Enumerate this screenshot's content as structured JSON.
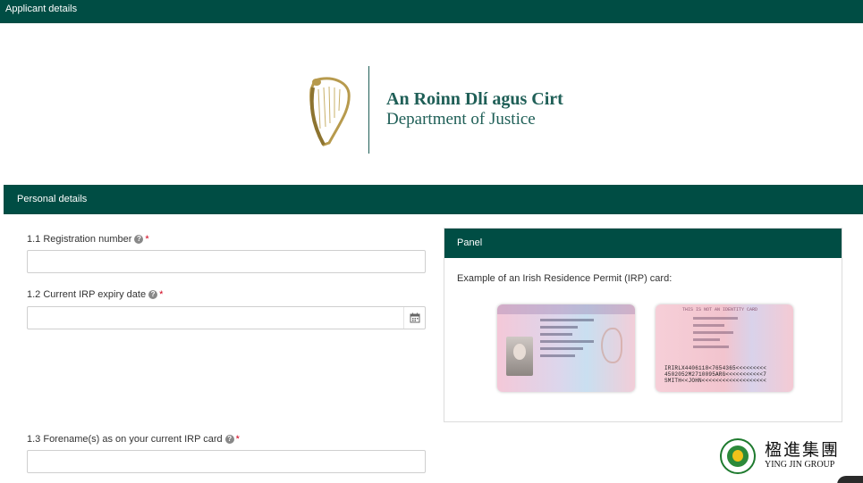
{
  "header": {
    "title": "Applicant details"
  },
  "logo": {
    "name_ga": "An Roinn Dlí agus Cirt",
    "name_en": "Department of Justice",
    "icon": "harp-icon"
  },
  "section": {
    "title": "Personal details"
  },
  "fields": {
    "registration_number": {
      "label": "1.1 Registration number",
      "value": "",
      "placeholder": ""
    },
    "irp_expiry": {
      "label": "1.2 Current IRP expiry date",
      "value": "",
      "placeholder": ""
    },
    "forenames": {
      "label": "1.3 Forename(s) as on your current IRP card",
      "value": "",
      "placeholder": ""
    },
    "help_glyph": "?",
    "required_marker": "*"
  },
  "panel": {
    "title": "Panel",
    "description": "Example of an Irish Residence Permit (IRP) card:",
    "card_back_banner": "THIS IS NOT AN IDENTITY CARD",
    "mrz": [
      "IRIRLX4406118<7654365<<<<<<<<<",
      "4502052M2710095ARG<<<<<<<<<<<7",
      "SMITH<<JOHN<<<<<<<<<<<<<<<<<<<"
    ]
  },
  "watermark": {
    "name_cn": "楹進集團",
    "name_en": "YING JIN GROUP"
  },
  "colors": {
    "brand_green": "#004d44",
    "logo_green": "#1f5f57",
    "required_red": "#d0021b"
  }
}
